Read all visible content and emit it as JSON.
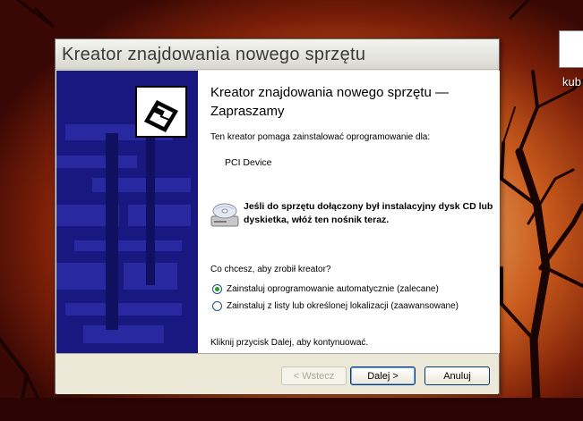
{
  "desktop": {
    "icon_label": "kub"
  },
  "window": {
    "title": "Kreator znajdowania nowego sprzętu"
  },
  "wizard": {
    "heading": "Kreator znajdowania nowego sprzętu — Zapraszamy",
    "intro": "Ten kreator pomaga zainstalować oprogramowanie dla:",
    "device_name": "PCI Device",
    "cd_note": "Jeśli do sprzętu dołączony był instalacyjny dysk CD lub dyskietka, włóż ten nośnik teraz.",
    "question": "Co chcesz, aby zrobił kreator?",
    "options": [
      {
        "label": "Zainstaluj oprogramowanie automatycznie (zalecane)",
        "selected": true
      },
      {
        "label": "Zainstaluj z listy lub określonej lokalizacji (zaawansowane)",
        "selected": false
      }
    ],
    "continue_hint": "Kliknij przycisk Dalej, aby kontynuować."
  },
  "buttons": {
    "back": "< Wstecz",
    "next": "Dalej >",
    "cancel": "Anuluj"
  },
  "colors": {
    "banner": "#181880",
    "radio_selected": "#21a121"
  }
}
